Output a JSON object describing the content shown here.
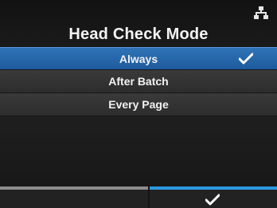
{
  "header": {
    "title": "Head Check Mode",
    "network_icon": "network-icon"
  },
  "options": [
    {
      "label": "Always",
      "selected": true
    },
    {
      "label": "After Batch",
      "selected": false
    },
    {
      "label": "Every Page",
      "selected": false
    }
  ],
  "footer": {
    "left_button_icon": "none",
    "right_button_icon": "checkmark-icon"
  },
  "colors": {
    "selected_row": "#2f73b8",
    "confirm_accent": "#2c9be0",
    "left_accent": "#8d8d8d"
  }
}
